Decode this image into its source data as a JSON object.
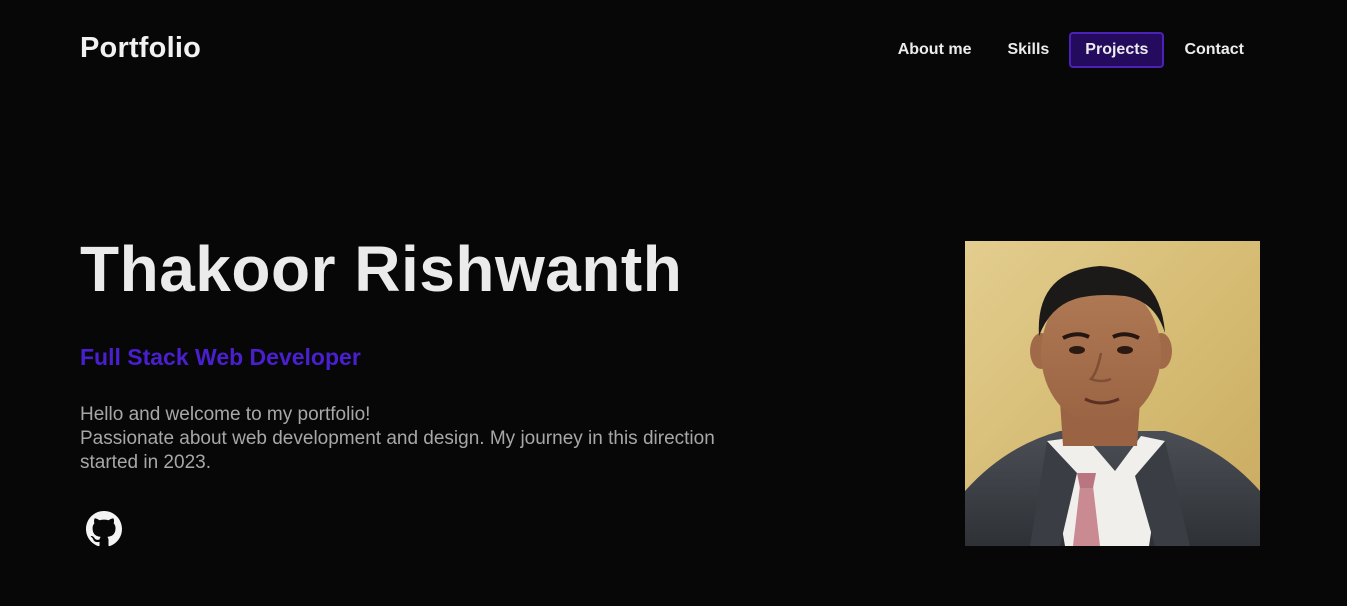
{
  "header": {
    "brand": "Portfolio",
    "nav": [
      {
        "label": "About me",
        "active": false
      },
      {
        "label": "Skills",
        "active": false
      },
      {
        "label": "Projects",
        "active": true
      },
      {
        "label": "Contact",
        "active": false
      }
    ]
  },
  "hero": {
    "name": "Thakoor Rishwanth",
    "role": "Full Stack Web Developer",
    "intro_line_1": "Hello and welcome to my portfolio!",
    "intro_line_2": "Passionate about web development and design. My journey in this direction started in 2023.",
    "social_icon": "github-icon",
    "photo_icon": "profile-photo"
  },
  "colors": {
    "background": "#070707",
    "accent": "#4a1fd0",
    "active_nav_bg": "#240b5e",
    "active_nav_border": "#4a22b8",
    "text_primary": "#ebebeb",
    "text_secondary": "#a7a7a7"
  }
}
